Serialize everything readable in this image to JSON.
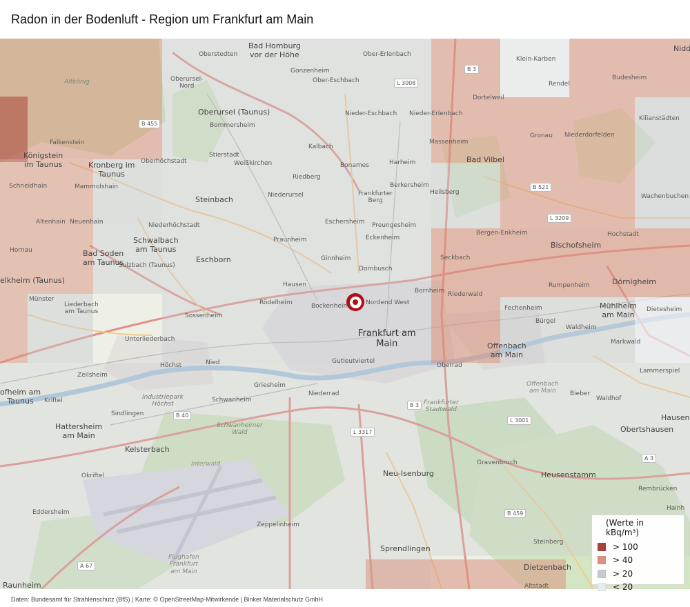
{
  "title": "Radon in der Bodenluft - Region um Frankfurt am Main",
  "footer": "Daten: Bundesamt für Strahlenschutz (BfS)  |  Karte: © OpenStreetMap-Mitwirkende  |  Binker Materialschutz GmbH",
  "colors": {
    "gt100": "#a8433b",
    "gt40": "#d89482",
    "gt20": "#c8cad1",
    "lt20": "#e8ebf0",
    "marker": "#b00d17"
  },
  "legend": {
    "title": "(Werte in kBq/m³)",
    "items": [
      {
        "label": "> 100",
        "color_key": "gt100"
      },
      {
        "label": "> 40",
        "color_key": "gt40"
      },
      {
        "label": "> 20",
        "color_key": "gt20"
      },
      {
        "label": "< 20",
        "color_key": "lt20"
      }
    ]
  },
  "places": {
    "bad_homburg": "Bad Homburg\nvor der Höhe",
    "ober_erlenbach": "Ober-Erlenbach",
    "oberstedten": "Oberstedten",
    "oberursel_nord": "Oberursel-\nNord",
    "gonzenheim": "Gonzenheim",
    "ober_eschbach": "Ober-Eschbach",
    "oberursel": "Oberursel (Taunus)",
    "bommersheim": "Bommersheim",
    "nieder_eschbach": "Nieder-Eschbach",
    "nieder_erlenbach": "Nieder-Erlenbach",
    "dortelweil": "Dortelweil",
    "klein_karben": "Klein-Karben",
    "rendel": "Rendel",
    "budesheim": "Budesheim",
    "nidd": "Nidd",
    "kilianstaedten": "Kilianstädten",
    "falkenstein": "Falkenstein",
    "koenigstein": "Königstein\nim Taunus",
    "kronberg": "Kronberg im\nTaunus",
    "oberhoechstadt": "Oberhöchstadt",
    "stierstadt": "Stierstadt",
    "weisskirchen": "Weißkirchen",
    "kalbach": "Kalbach",
    "bonames": "Bonames",
    "harheim": "Harheim",
    "massenheim": "Massenheim",
    "gronau": "Gronau",
    "niederdorfelden": "Niederdorfelden",
    "bad_vilbel": "Bad Vilbel",
    "schneidhain": "Schneidhain",
    "mammolshain": "Mammolshain",
    "steinbach": "Steinbach",
    "riedberg": "Riedberg",
    "berkersheim": "Berkersheim",
    "heilsberg": "Heilsberg",
    "wachenbuchen": "Wachenbuchen",
    "altenhain": "Altenhain",
    "neuenhain": "Neuenhain",
    "niederhoechstadt": "Niederhöchstadt",
    "niederursel": "Niederursel",
    "frankfurter_berg": "Frankfurter\nBerg",
    "eschersheim": "Eschersheim",
    "preungesheim": "Preungesheim",
    "hochstadt": "Hochstadt",
    "schwalbach": "Schwalbach\nam Taunus",
    "praunheim": "Praunheim",
    "eckenheim": "Eckenheim",
    "bergen_enkheim": "Bergen-Enkheim",
    "bischofsheim": "Bischofsheim",
    "hornau": "Hornau",
    "bad_soden": "Bad Soden\nam Taunus",
    "eschborn": "Eschborn",
    "ginnheim": "Ginnheim",
    "dornbusch": "Dornbusch",
    "seckbach": "Seckbach",
    "doernigheim": "Dörnigheim",
    "hofheim": "elkheim (Taunus)",
    "sulzbach": "Sulzbach (Taunus)",
    "hausen": "Hausen",
    "rumpenheim": "Rumpenheim",
    "bornheim": "Bornheim",
    "riederwald": "Riederwald",
    "muenster": "Münster",
    "liederbach": "Liederbach\nam Taunus",
    "roedelheim": "Rödelheim",
    "bockenheim": "Bockenheim",
    "nordend_west": "Nordend West",
    "fechenheim": "Fechenheim",
    "muehlheim": "Mühlheim\nam Main",
    "dietesheim": "Dietesheim",
    "sossenheim": "Sossenheim",
    "burgel": "Bürgel",
    "waldheim": "Waldheim",
    "frankfurt": "Frankfurt am\nMain",
    "unterliederbach": "Unterliederbach",
    "offenbach": "Offenbach\nam Main",
    "markwald": "Markwald",
    "nied": "Nied",
    "hoechst": "Höchst",
    "gutleutviertel": "Gutleutviertel",
    "oberrad": "Oberrad",
    "lammerspiel": "Lammerspiel",
    "zeilsheim": "Zeilsheim",
    "griesheim": "Griesheim",
    "offenbach_small": "Offenbach\nam Main",
    "bieber": "Bieber",
    "hofheim_main": "ofheim am\nTaunus",
    "kriftel": "Kriftel",
    "industriepark": "Industriepark\nHöchst",
    "niederrad": "Niederrad",
    "waldhof": "Waldhof",
    "schwanheim": "Schwanheim",
    "frankfurter_stadtwald": "Frankfurter\nStadtwald",
    "sindlingen": "Sindlingen",
    "hausen_east": "Hausen",
    "hattersheim": "Hattersheim\nam Main",
    "schwanheimer_wald": "Schwanheimer\nWald",
    "obertshausen": "Obertshausen",
    "kelsterbach": "Kelsterbach",
    "gravenbruch": "Gravenbruch",
    "okriftel": "Okriftel",
    "neu_isenburg": "Neu-Isenburg",
    "heusenstamm": "Heusenstamm",
    "rembruecken": "Rembrücken",
    "eddersheim": "Eddersheim",
    "zeppelinheim": "Zeppelinheim",
    "steinberg": "Steinberg",
    "hainh": "Hainh",
    "sprendlingen": "Sprendlingen",
    "flughafen": "Flughafen\nFrankfurt\nam Main",
    "dietzenbach": "Dietzenbach",
    "raunheim": "Raunheim",
    "altstadt": "Altstadt",
    "altkoenig": "Altkönig",
    "interwald": "Interwald"
  },
  "roads": {
    "b455": "B 455",
    "l3008": "L 3008",
    "b3_north": "B 3",
    "b521": "B 521",
    "l3209": "L 3209",
    "b40": "B 40",
    "b3_south": "B 3",
    "l3317": "L 3317",
    "l3001": "L 3001",
    "a3": "A 3",
    "b459": "B 459",
    "a67": "A 67"
  }
}
